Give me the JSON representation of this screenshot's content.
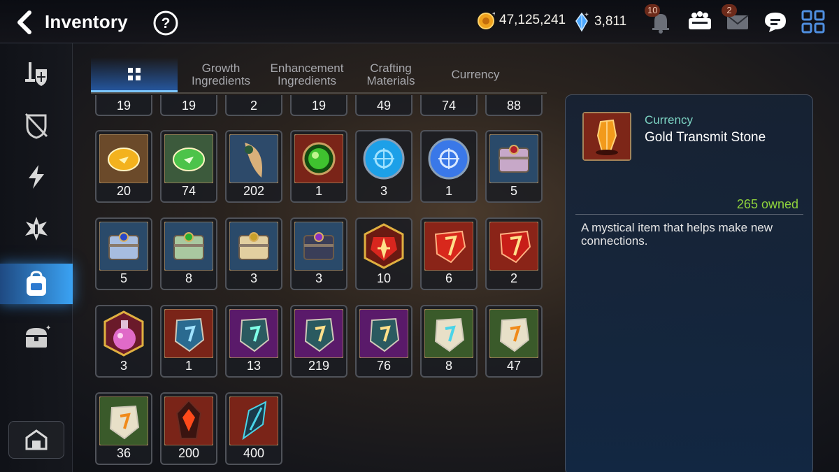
{
  "header": {
    "title": "Inventory",
    "gold": "47,125,241",
    "crystals": "3,811",
    "notifications_badge": "10",
    "mail_badge": "2"
  },
  "sidebar": {
    "items": [
      {
        "icon": "sword-shield-icon"
      },
      {
        "icon": "broken-shield-icon"
      },
      {
        "icon": "lightning-icon"
      },
      {
        "icon": "burst-icon"
      },
      {
        "icon": "backpack-icon",
        "active": true
      },
      {
        "icon": "treasure-chest-icon"
      }
    ],
    "bottom_icon": "guild-house-icon"
  },
  "tabs": [
    {
      "label": "",
      "icon": "grid-icon",
      "active": true
    },
    {
      "label": "Growth\nIngredients"
    },
    {
      "label": "Enhancement\nIngredients"
    },
    {
      "label": "Crafting\nMaterials"
    },
    {
      "label": "Currency"
    }
  ],
  "items": [
    {
      "count": "19",
      "icon": "partial"
    },
    {
      "count": "19",
      "icon": "partial"
    },
    {
      "count": "2",
      "icon": "partial"
    },
    {
      "count": "19",
      "icon": "partial"
    },
    {
      "count": "49",
      "icon": "partial"
    },
    {
      "count": "74",
      "icon": "partial"
    },
    {
      "count": "88",
      "icon": "partial"
    },
    {
      "count": "20",
      "icon": "gold-rune-icon"
    },
    {
      "count": "74",
      "icon": "green-rune-icon"
    },
    {
      "count": "202",
      "icon": "feather-charm-icon"
    },
    {
      "count": "1",
      "icon": "green-orb-icon"
    },
    {
      "count": "3",
      "icon": "blue-sigil-icon"
    },
    {
      "count": "1",
      "icon": "blue-crystal-icon"
    },
    {
      "count": "5",
      "icon": "purple-chest-icon"
    },
    {
      "count": "5",
      "icon": "blue-chest-icon"
    },
    {
      "count": "8",
      "icon": "green-chest-icon"
    },
    {
      "count": "3",
      "icon": "gold-chest-icon"
    },
    {
      "count": "3",
      "icon": "dark-chest-icon"
    },
    {
      "count": "10",
      "icon": "red-star-gem-icon"
    },
    {
      "count": "6",
      "icon": "red-gem-t-icon"
    },
    {
      "count": "2",
      "icon": "red-gem-slash-icon"
    },
    {
      "count": "3",
      "icon": "pink-potion-icon"
    },
    {
      "count": "1",
      "icon": "blue-rune-stone-icon"
    },
    {
      "count": "13",
      "icon": "teal-star-stone-icon"
    },
    {
      "count": "219",
      "icon": "teal-t-stone-icon"
    },
    {
      "count": "76",
      "icon": "teal-slash-stone-icon"
    },
    {
      "count": "8",
      "icon": "white-star-stone-icon"
    },
    {
      "count": "47",
      "icon": "white-t-stone-icon"
    },
    {
      "count": "36",
      "icon": "white-slash-stone-icon"
    },
    {
      "count": "200",
      "icon": "dark-red-crystal-icon"
    },
    {
      "count": "400",
      "icon": "dark-teal-shard-icon"
    }
  ],
  "detail": {
    "category": "Currency",
    "name": "Gold Transmit Stone",
    "owned": "265 owned",
    "description": "A mystical item that helps make new connections."
  },
  "colors": {
    "accent": "#3aa0ff",
    "owned": "#8fd33c",
    "category": "#7cd3c3"
  }
}
